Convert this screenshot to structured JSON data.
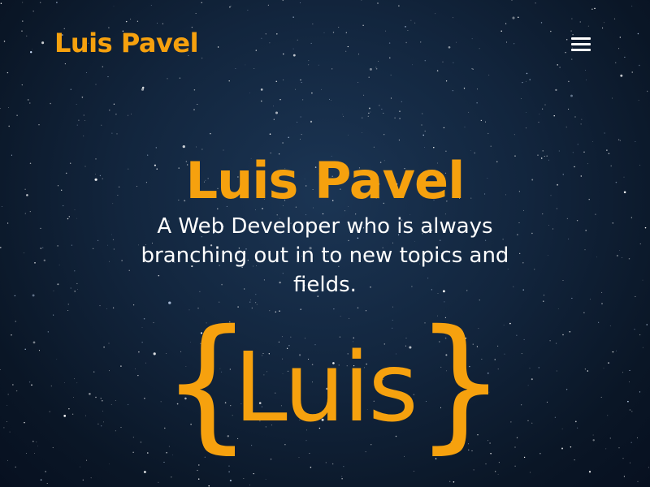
{
  "colors": {
    "accent": "#f6a10e",
    "text": "#ffffff",
    "background": "#12253d"
  },
  "navbar": {
    "brand": "Luis Pavel",
    "menu_icon": "hamburger-menu-icon"
  },
  "hero": {
    "title": "Luis Pavel",
    "tagline": "A Web Developer who is always branching out in to new topics and fields."
  },
  "logo": {
    "open_brace": "{",
    "word": "Luis",
    "close_brace": "}"
  }
}
